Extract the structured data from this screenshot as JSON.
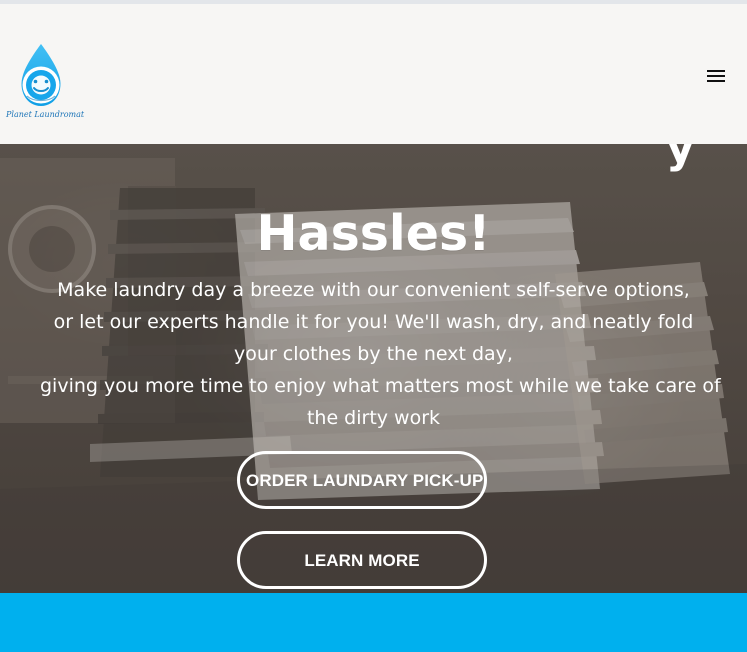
{
  "brand": {
    "name": "Planet Laundromat",
    "logo_text": "Planet Laundromat"
  },
  "navigation": {
    "menu_icon": "hamburger-menu-icon"
  },
  "hero": {
    "cutoff_text": "y",
    "title": "Hassles!",
    "description_lines": [
      "Make laundry day a breeze with our convenient self-serve options,",
      "or let our experts handle it for you! We'll wash, dry, and neatly fold",
      "your clothes by the next day,",
      "giving you more time to enjoy what matters most while we take care of",
      "the dirty work"
    ],
    "buttons": {
      "pickup": "ORDER LAUNDARY PICK-UP",
      "learn_more": "LEARN MORE"
    }
  },
  "colors": {
    "header_bg": "#f7f6f4",
    "hero_text": "#ffffff",
    "accent_blue": "#00b0ee",
    "logo_blue": "#1f9ee7"
  }
}
